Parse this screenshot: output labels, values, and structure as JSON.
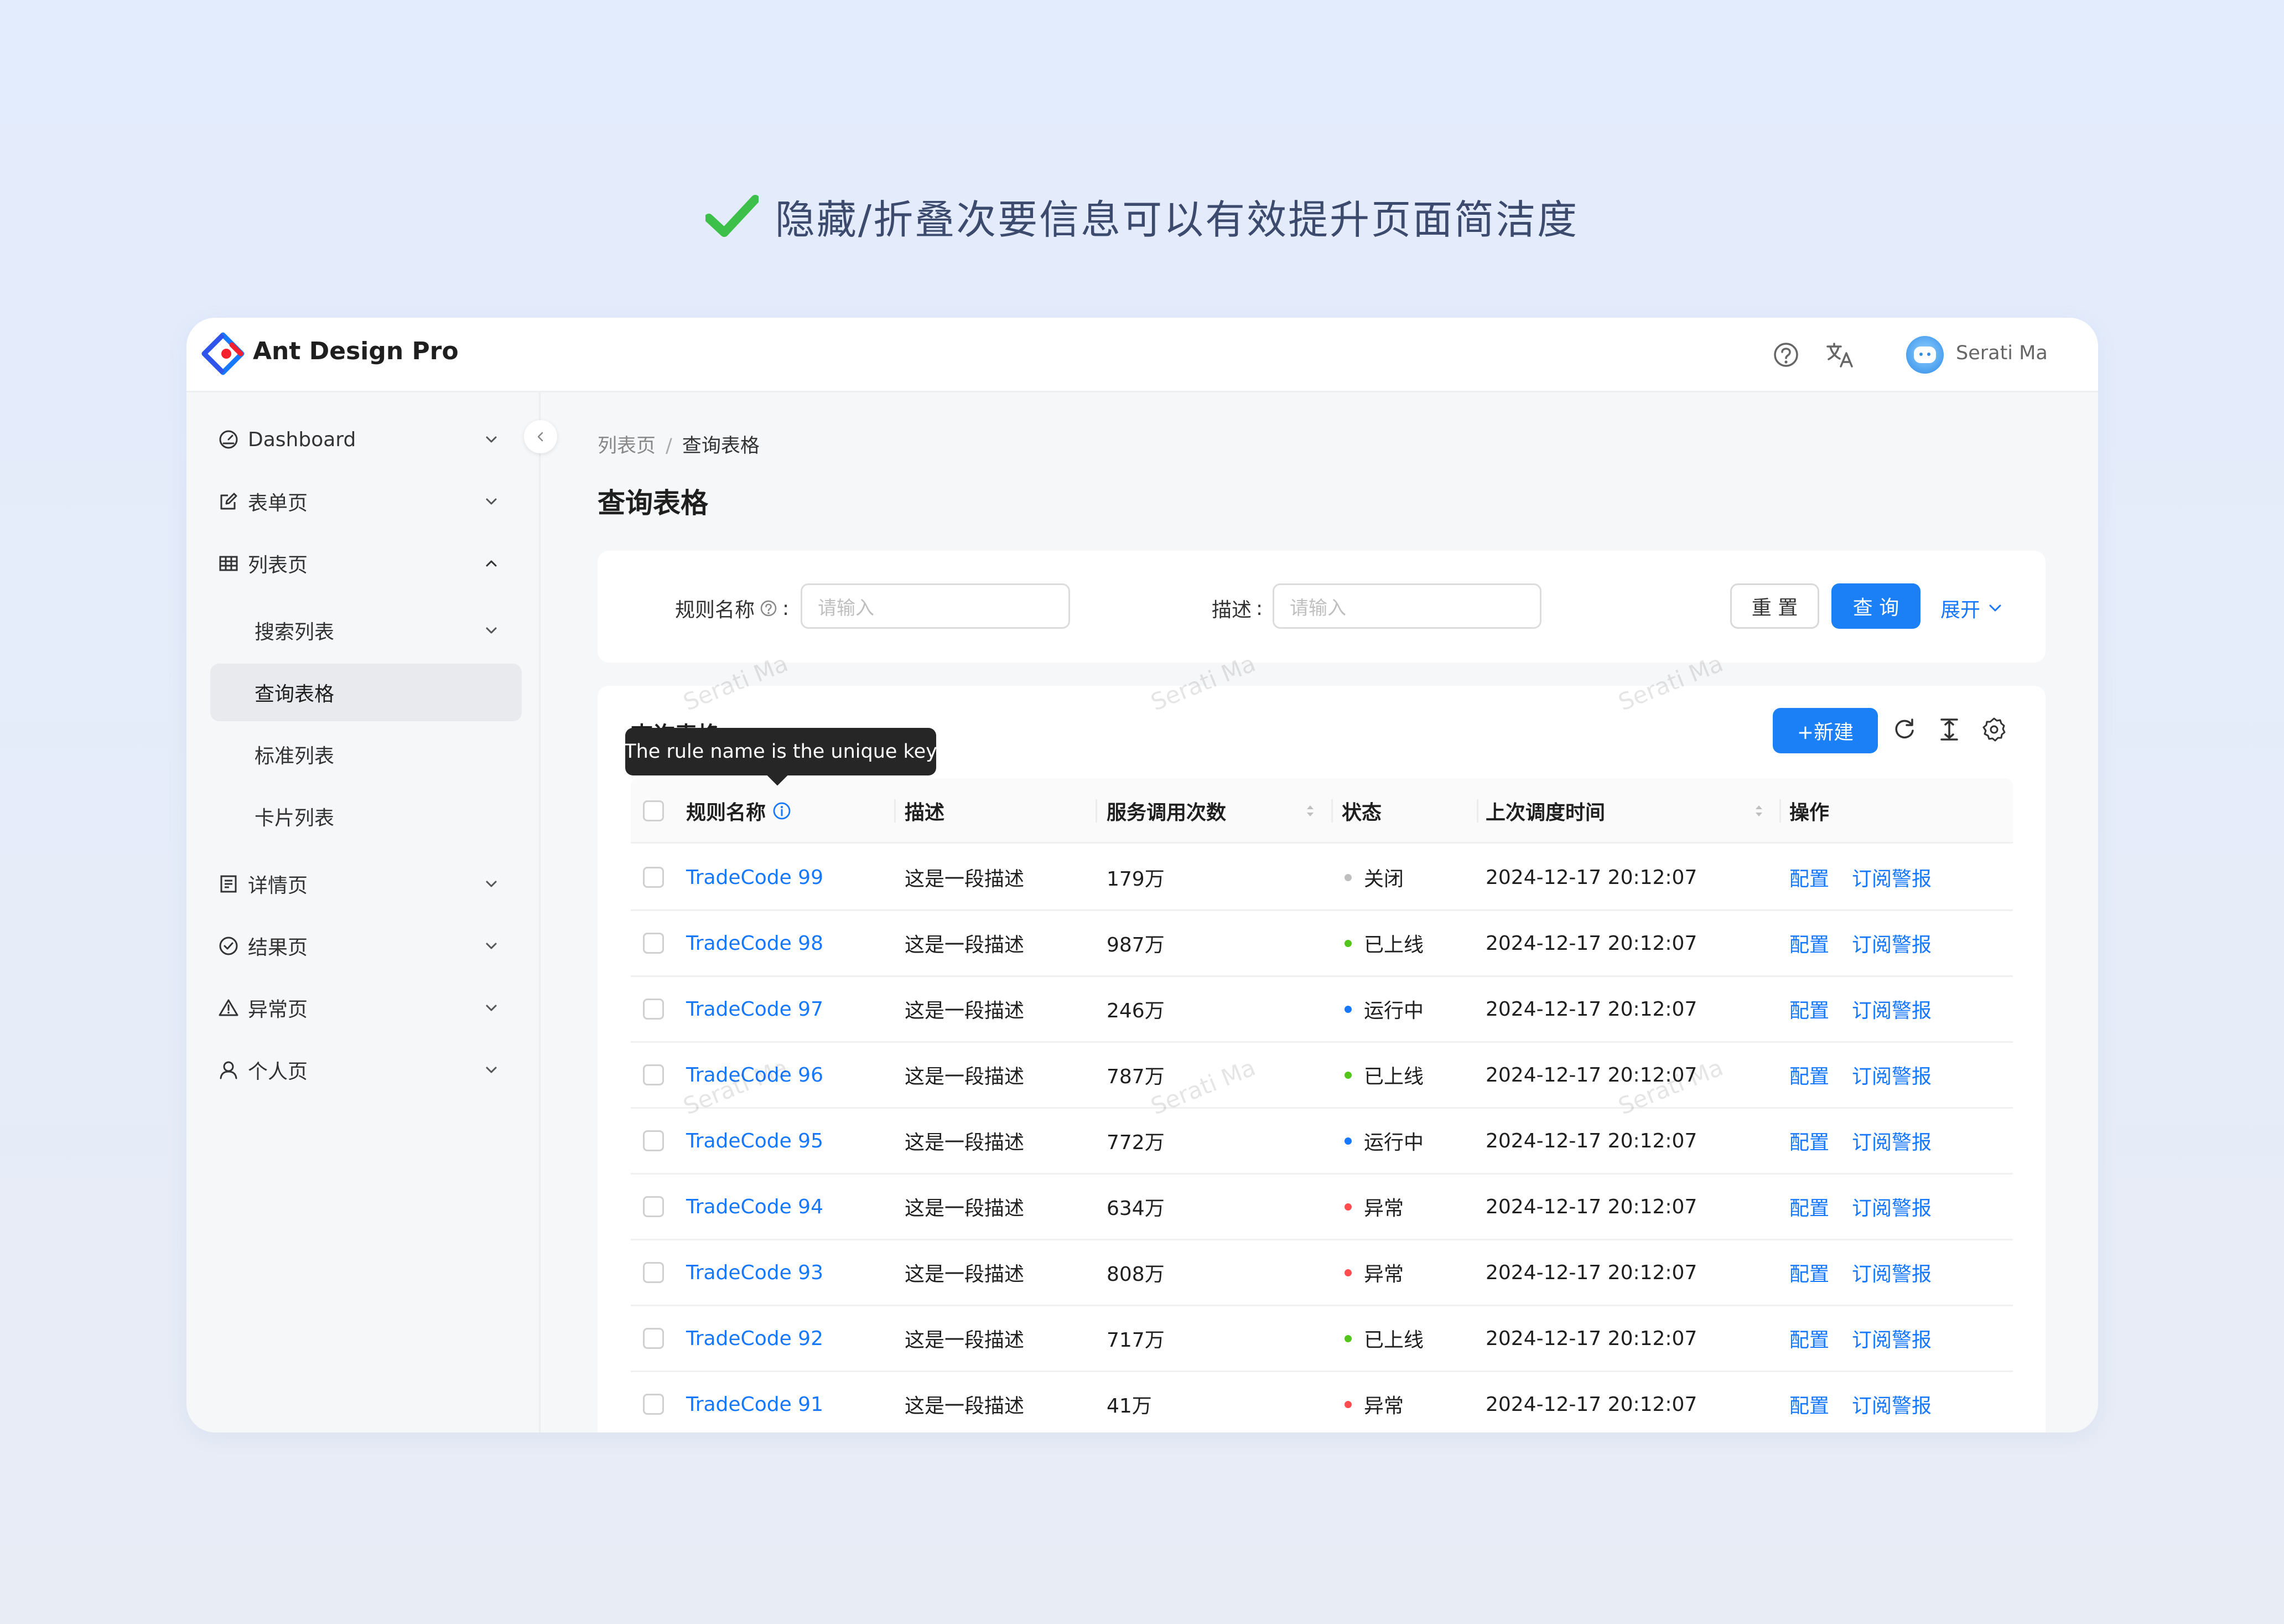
{
  "caption": "隐藏/折叠次要信息可以有效提升页面简洁度",
  "app": {
    "title": "Ant Design Pro",
    "user_name": "Serati Ma"
  },
  "icons": {
    "caption": "check-mark-icon",
    "logo": "ant-design-logo-icon",
    "help": "question-circle-icon",
    "language": "translate-icon",
    "collapse": "chevron-left-icon"
  },
  "sidebar": {
    "items": [
      {
        "label": "Dashboard",
        "icon": "dashboard-icon",
        "chevron": "down"
      },
      {
        "label": "表单页",
        "icon": "form-edit-icon",
        "chevron": "down"
      },
      {
        "label": "列表页",
        "icon": "table-icon",
        "chevron": "up"
      },
      {
        "label": "搜索列表",
        "chevron": "down"
      },
      {
        "label": "查询表格",
        "selected": true
      },
      {
        "label": "标准列表"
      },
      {
        "label": "卡片列表"
      },
      {
        "label": "详情页",
        "icon": "profile-icon",
        "chevron": "down"
      },
      {
        "label": "结果页",
        "icon": "check-circle-icon",
        "chevron": "down"
      },
      {
        "label": "异常页",
        "icon": "warning-icon",
        "chevron": "down"
      },
      {
        "label": "个人页",
        "icon": "user-icon",
        "chevron": "down"
      }
    ]
  },
  "breadcrumb": {
    "parent": "列表页",
    "separator": "/",
    "current": "查询表格"
  },
  "page_title": "查询表格",
  "search": {
    "rule_label": "规则名称",
    "rule_colon": ":",
    "rule_placeholder": "请输入",
    "desc_label": "描述",
    "desc_colon": ":",
    "desc_placeholder": "请输入",
    "reset_label": "重 置",
    "query_label": "查 询",
    "expand_label": "展开"
  },
  "table": {
    "title": "查询表格",
    "new_label": "+新建",
    "tooltip": "The rule name is the unique key",
    "columns": [
      "规则名称",
      "描述",
      "服务调用次数",
      "状态",
      "上次调度时间",
      "操作"
    ],
    "action_config": "配置",
    "action_subscribe": "订阅警报",
    "rows": [
      {
        "name": "TradeCode 99",
        "desc": "这是一段描述",
        "calls": "179万",
        "status": "关闭",
        "status_color": "#bfbfbf",
        "time": "2024-12-17 20:12:07"
      },
      {
        "name": "TradeCode 98",
        "desc": "这是一段描述",
        "calls": "987万",
        "status": "已上线",
        "status_color": "#52c41a",
        "time": "2024-12-17 20:12:07"
      },
      {
        "name": "TradeCode 97",
        "desc": "这是一段描述",
        "calls": "246万",
        "status": "运行中",
        "status_color": "#1677ff",
        "time": "2024-12-17 20:12:07"
      },
      {
        "name": "TradeCode 96",
        "desc": "这是一段描述",
        "calls": "787万",
        "status": "已上线",
        "status_color": "#52c41a",
        "time": "2024-12-17 20:12:07"
      },
      {
        "name": "TradeCode 95",
        "desc": "这是一段描述",
        "calls": "772万",
        "status": "运行中",
        "status_color": "#1677ff",
        "time": "2024-12-17 20:12:07"
      },
      {
        "name": "TradeCode 94",
        "desc": "这是一段描述",
        "calls": "634万",
        "status": "异常",
        "status_color": "#ff4d4f",
        "time": "2024-12-17 20:12:07"
      },
      {
        "name": "TradeCode 93",
        "desc": "这是一段描述",
        "calls": "808万",
        "status": "异常",
        "status_color": "#ff4d4f",
        "time": "2024-12-17 20:12:07"
      },
      {
        "name": "TradeCode 92",
        "desc": "这是一段描述",
        "calls": "717万",
        "status": "已上线",
        "status_color": "#52c41a",
        "time": "2024-12-17 20:12:07"
      },
      {
        "name": "TradeCode 91",
        "desc": "这是一段描述",
        "calls": "41万",
        "status": "异常",
        "status_color": "#ff4d4f",
        "time": "2024-12-17 20:12:07"
      }
    ]
  },
  "watermark": "Serati Ma",
  "colors": {
    "primary": "#1677ff",
    "button_primary": "#1b7ff5",
    "check": "#3cc04a"
  }
}
